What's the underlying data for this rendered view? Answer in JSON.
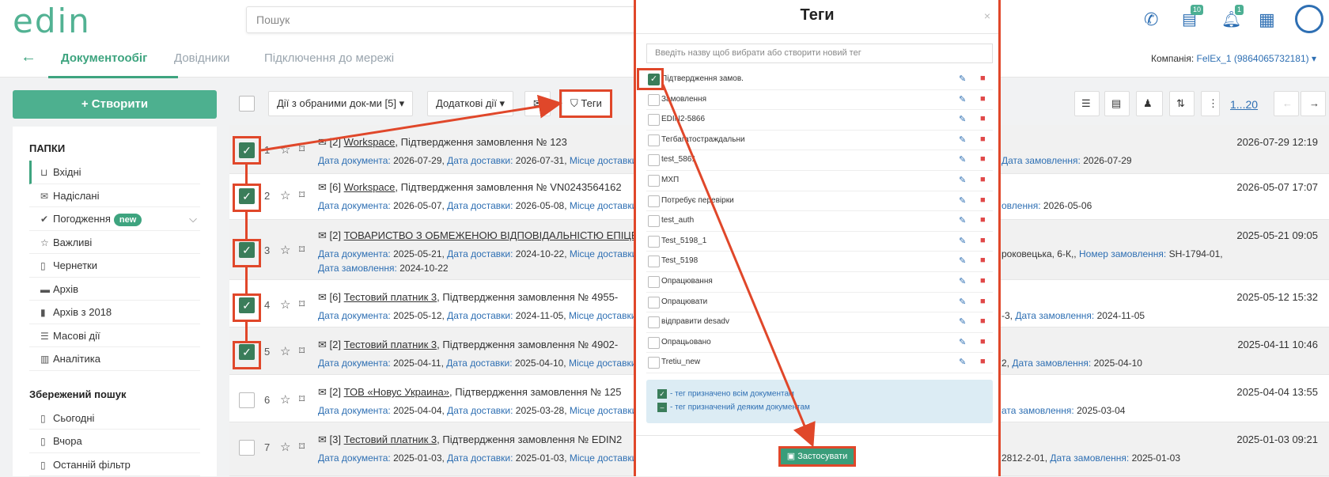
{
  "app": {
    "logo": "edin",
    "search_placeholder": "Пошук",
    "news_badge": "10",
    "notif_badge": "1"
  },
  "nav": {
    "back": "←",
    "tabs": [
      "Документообіг",
      "Довідники",
      "Підключення до мережі"
    ],
    "company_label": "Компанія:",
    "company_value": "FelEx_1 (9864065732181) ▾"
  },
  "create_label": "+ Створити",
  "sidebar": {
    "folders_title": "ПАПКИ",
    "folders": [
      {
        "label": "Вхідні",
        "icon": "inbox-icon"
      },
      {
        "label": "Надіслані",
        "icon": "envelope-icon"
      },
      {
        "label": "Погодження",
        "icon": "check-icon",
        "badge": "new"
      },
      {
        "label": "Важливі",
        "icon": "star-icon"
      },
      {
        "label": "Чернетки",
        "icon": "draft-icon"
      },
      {
        "label": "Архів",
        "icon": "archive-icon"
      },
      {
        "label": "Архів з 2018",
        "icon": "file-icon"
      },
      {
        "label": "Масові дії",
        "icon": "bulk-icon"
      },
      {
        "label": "Аналітика",
        "icon": "chart-icon"
      }
    ],
    "saved_title": "Збережений пошук",
    "saved": [
      "Сьогодні",
      "Вчора",
      "Останній фільтр"
    ]
  },
  "toolbar": {
    "actions_label": "Дії з обраними док-ми [5] ▾",
    "extra_label": "Додаткові дії ▾",
    "tags_label": "Теги",
    "pages": "1...20"
  },
  "rows": [
    {
      "n": "1",
      "checked": true,
      "title_prefix": "[2]",
      "org": "Workspace",
      "title_rest": ", Підтвердження замовлення № 123",
      "doc_date_k": "Дата документа:",
      "doc_date": "2026-07-29",
      "del_k": "Дата доставки:",
      "del": "2026-07-31",
      "place_k": "Місце доставки",
      "right_k": "Дата замовлення:",
      "right_v": "2026-07-29",
      "right_pre": "",
      "dt": "2026-07-29 12:19"
    },
    {
      "n": "2",
      "checked": true,
      "title_prefix": "[6]",
      "org": "Workspace",
      "title_rest": ", Підтвердження замовлення № VN0243564162",
      "doc_date_k": "Дата документа:",
      "doc_date": "2026-05-07",
      "del_k": "Дата доставки:",
      "del": "2026-05-08",
      "place_k": "Місце доставки",
      "right_k": "овлення:",
      "right_v": "2026-05-06",
      "right_pre": "",
      "dt": "2026-05-07 17:07"
    },
    {
      "n": "3",
      "checked": true,
      "title_prefix": "[2]",
      "org": "ТОВАРИСТВО З ОБМЕЖЕНОЮ ВІДПОВІДАЛЬНІСТЮ ЕПІЦЕН",
      "title_rest": "",
      "doc_date_k": "Дата документа:",
      "doc_date": "2025-05-21",
      "del_k": "Дата доставки:",
      "del": "2024-10-22",
      "place_k": "Місце доставки",
      "right_pre": "роковецька, 6-К,,",
      "right_k": "Номер замовлення:",
      "right_v": "SH-1794-01,",
      "extra_k": "Дата замовлення:",
      "extra_v": "2024-10-22",
      "dt": "2025-05-21 09:05"
    },
    {
      "n": "4",
      "checked": true,
      "title_prefix": "[6]",
      "org": "Тестовий платник 3",
      "title_rest": ", Підтвердження замовлення № 4955-",
      "doc_date_k": "Дата документа:",
      "doc_date": "2025-05-12",
      "del_k": "Дата доставки:",
      "del": "2024-11-05",
      "place_k": "Місце доставки",
      "right_pre": "-3,",
      "right_k": "Дата замовлення:",
      "right_v": "2024-11-05",
      "dt": "2025-05-12 15:32"
    },
    {
      "n": "5",
      "checked": true,
      "title_prefix": "[2]",
      "org": "Тестовий платник 3",
      "title_rest": ", Підтвердження замовлення № 4902-",
      "doc_date_k": "Дата документа:",
      "doc_date": "2025-04-11",
      "del_k": "Дата доставки:",
      "del": "2025-04-10",
      "place_k": "Місце доставки",
      "right_pre": "2,",
      "right_k": "Дата замовлення:",
      "right_v": "2025-04-10",
      "dt": "2025-04-11 10:46"
    },
    {
      "n": "6",
      "checked": false,
      "title_prefix": "[2]",
      "org": "ТОВ «Новус Украина»",
      "title_rest": ", Підтвердження замовлення № 125",
      "doc_date_k": "Дата документа:",
      "doc_date": "2025-04-04",
      "del_k": "Дата доставки:",
      "del": "2025-03-28",
      "place_k": "Місце доставки",
      "right_pre": "",
      "right_k": "ата замовлення:",
      "right_v": "2025-03-04",
      "dt": "2025-04-04 13:55"
    },
    {
      "n": "7",
      "checked": false,
      "title_prefix": "[3]",
      "org": "Тестовий платник 3",
      "title_rest": ", Підтвердження замовлення № EDIN2",
      "doc_date_k": "Дата документа:",
      "doc_date": "2025-01-03",
      "del_k": "Дата доставки:",
      "del": "2025-01-03",
      "place_k": "Місце доставки",
      "right_pre": "2812-2-01,",
      "right_k": "Дата замовлення:",
      "right_v": "2025-01-03",
      "dt": "2025-01-03 09:21"
    }
  ],
  "modal": {
    "title": "Теги",
    "close": "×",
    "input_placeholder": "Введіть назву щоб вибрати або створити новий тег",
    "tags": [
      {
        "label": "Підтвердження замов.",
        "checked": true
      },
      {
        "label": "Замовлення",
        "checked": false
      },
      {
        "label": "EDIN2-5866",
        "checked": false
      },
      {
        "label": "Тегбагатостраждальни",
        "checked": false
      },
      {
        "label": "test_5861",
        "checked": false
      },
      {
        "label": "МХП",
        "checked": false
      },
      {
        "label": "Потребує перевірки",
        "checked": false
      },
      {
        "label": "test_auth",
        "checked": false
      },
      {
        "label": "Test_5198_1",
        "checked": false
      },
      {
        "label": "Test_5198",
        "checked": false
      },
      {
        "label": "Опрацювання",
        "checked": false
      },
      {
        "label": "Опрацювати",
        "checked": false
      },
      {
        "label": "відправити desadv",
        "checked": false
      },
      {
        "label": "Опрацьовано",
        "checked": false
      },
      {
        "label": "Tretiu_new",
        "checked": false
      }
    ],
    "legend_all": "- тег призначено всім документам",
    "legend_some": "- тег призначений деяким документам",
    "apply_label": "Застосувати"
  },
  "colors": {
    "accent": "#3ea47f",
    "highlight": "#e0472a",
    "link": "#2e6fb3"
  }
}
